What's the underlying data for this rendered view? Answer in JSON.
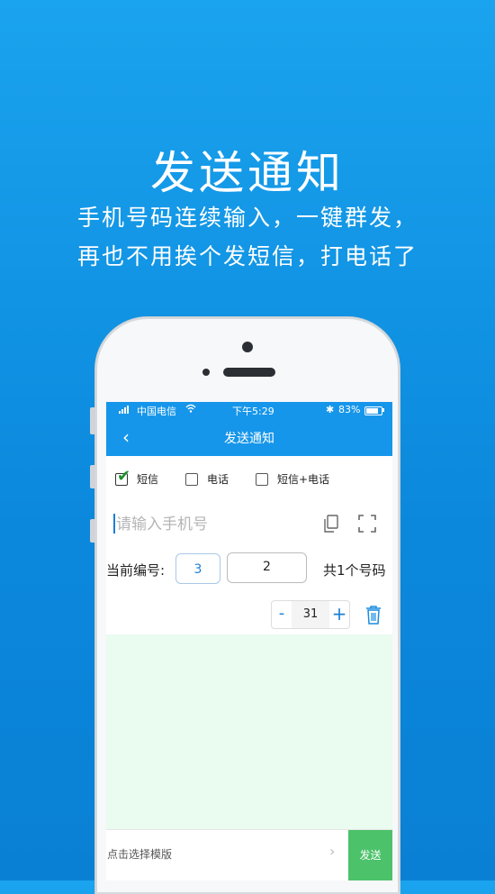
{
  "hero": {
    "title": "发送通知",
    "line1": "手机号码连续输入，一键群发，",
    "line2": "再也不用挨个发短信，打电话了"
  },
  "status_bar": {
    "carrier": "中国电信",
    "time": "下午5:29",
    "battery": "83%",
    "bluetooth": "✱"
  },
  "nav": {
    "back": "‹",
    "title": "发送通知"
  },
  "options": [
    {
      "label": "短信",
      "checked": true
    },
    {
      "label": "电话",
      "checked": false
    },
    {
      "label": "短信+电话",
      "checked": false
    }
  ],
  "phone_input": {
    "placeholder": "请输入手机号",
    "value": ""
  },
  "numbering": {
    "label": "当前编号:",
    "box_a": "3",
    "box_b": "2",
    "total": "共1个号码"
  },
  "stepper": {
    "minus": "-",
    "value": "31",
    "plus": "+"
  },
  "bottom": {
    "template_label": "点击选择模版",
    "chevron": "›",
    "send": "发送"
  },
  "colors": {
    "accent": "#1696ea",
    "send": "#4cc26a",
    "list_bg": "#eafbef"
  }
}
